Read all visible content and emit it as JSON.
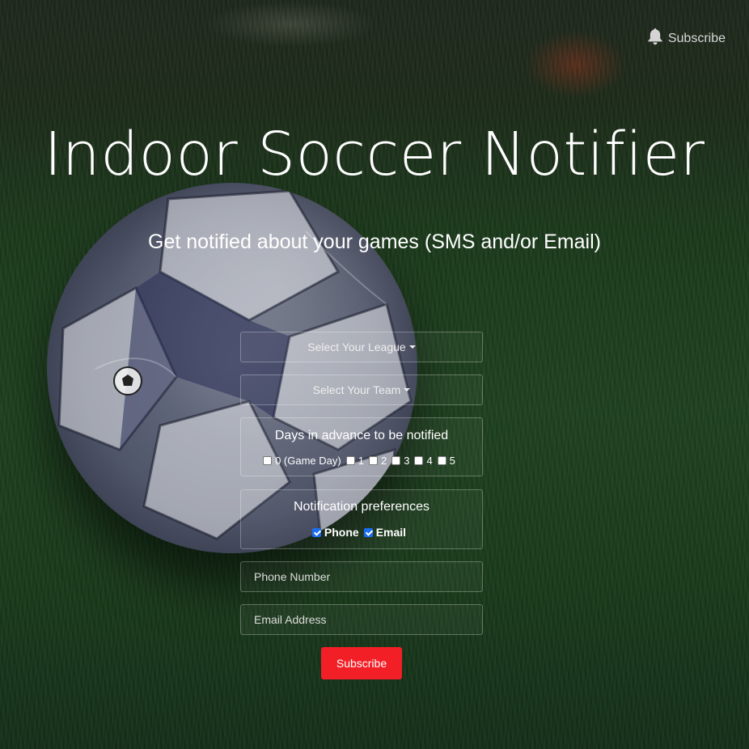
{
  "header": {
    "subscribe_label": "Subscribe",
    "icon": "bell-icon"
  },
  "hero": {
    "title": "Indoor Soccer Notifier",
    "subtitle": "Get notified about your games (SMS and/or Email)"
  },
  "form": {
    "league_label": "Select Your League",
    "team_label": "Select Your Team",
    "days": {
      "title": "Days in advance to be notified",
      "options": [
        {
          "label": "0 (Game Day)",
          "checked": false
        },
        {
          "label": "1",
          "checked": false
        },
        {
          "label": "2",
          "checked": false
        },
        {
          "label": "3",
          "checked": false
        },
        {
          "label": "4",
          "checked": false
        },
        {
          "label": "5",
          "checked": false
        }
      ]
    },
    "prefs": {
      "title": "Notification preferences",
      "options": [
        {
          "label": "Phone",
          "checked": true
        },
        {
          "label": "Email",
          "checked": true
        }
      ]
    },
    "phone_placeholder": "Phone Number",
    "email_placeholder": "Email Address",
    "submit_label": "Subscribe"
  },
  "colors": {
    "accent": "#f31f26",
    "checkbox": "#1b6df2"
  }
}
